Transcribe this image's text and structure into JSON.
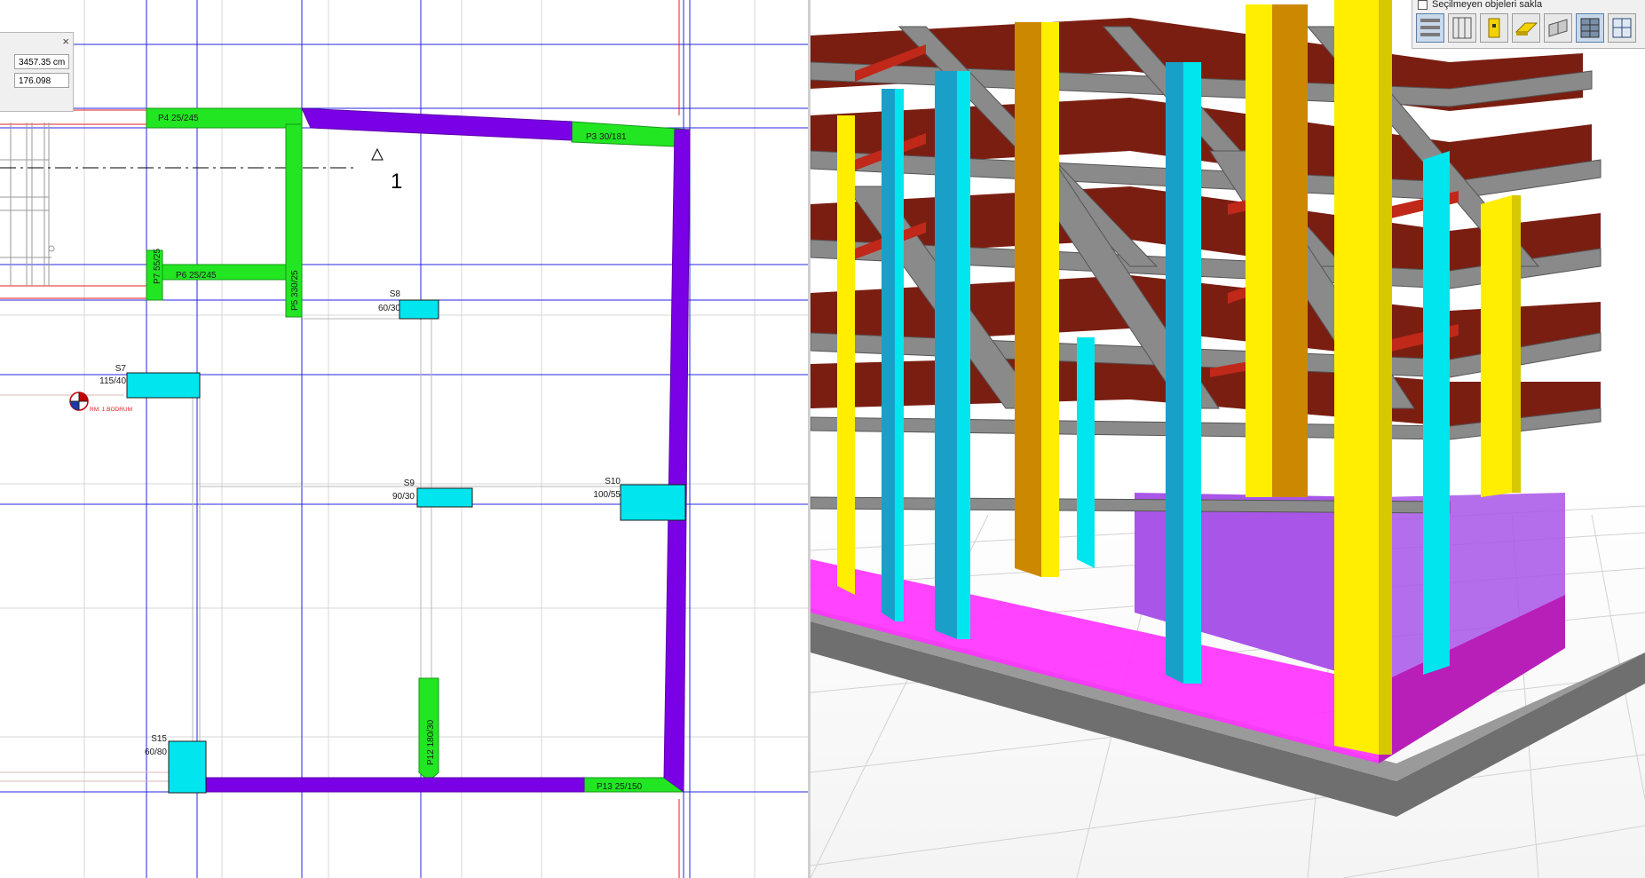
{
  "plan": {
    "coord_dialog": {
      "close_glyph": "×",
      "distance_value": "3457.35 cm",
      "angle_value": "176.098"
    },
    "section_marker_label": "1",
    "elevation_marker_label": "RM: 1.BODRUM",
    "walls": [
      {
        "id": "P4",
        "label": "P4 25/245"
      },
      {
        "id": "P3",
        "label": "P3 30/181"
      },
      {
        "id": "P6",
        "label": "P6 25/245"
      },
      {
        "id": "P7",
        "label": "P7 55/25"
      },
      {
        "id": "P5",
        "label": "P5 330/25"
      },
      {
        "id": "P12",
        "label": "P12 180/30"
      },
      {
        "id": "P13",
        "label": "P13 25/150"
      }
    ],
    "columns": [
      {
        "name": "S8",
        "size": "60/30"
      },
      {
        "name": "S7",
        "size": "115/40"
      },
      {
        "name": "S9",
        "size": "90/30"
      },
      {
        "name": "S10",
        "size": "100/55"
      },
      {
        "name": "S15",
        "size": "60/80"
      }
    ]
  },
  "view3d": {
    "toolbar": {
      "hide_unselected_label": "Seçilmeyen objeleri sakla",
      "hide_unselected_checked": false,
      "buttons": [
        {
          "name": "story-view-icon",
          "active": true
        },
        {
          "name": "elevation-view-icon",
          "active": false
        },
        {
          "name": "column-view-icon",
          "active": false
        },
        {
          "name": "slab-view-icon",
          "active": false
        },
        {
          "name": "wall-view-icon",
          "active": false
        },
        {
          "name": "building-view-icon",
          "active": true
        },
        {
          "name": "grid-view-icon",
          "active": false
        }
      ]
    }
  },
  "colors": {
    "axis_line": "#2424e0",
    "wall_green": "#22e622",
    "wall_purple": "#7a00e6",
    "column_cyan": "#00e5ee",
    "slab_red": "#7a1e12",
    "beam_gray": "#8a8a8a",
    "column_yellow": "#ffee00",
    "column_orange": "#cc8800",
    "column_blue": "#1aa0c8",
    "wall_lilac": "#a855e8",
    "floor_magenta": "#ff33ff"
  }
}
